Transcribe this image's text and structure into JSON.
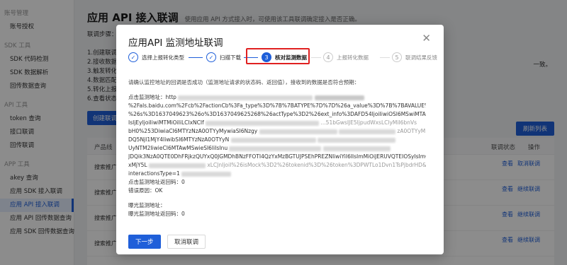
{
  "sidebar": {
    "sections": [
      {
        "group": "账号管理",
        "items": [
          "账号授权"
        ]
      },
      {
        "group": "SDK 工具",
        "items": [
          "SDK 代码检测",
          "SDK 数据解析",
          "回传数据查询"
        ]
      },
      {
        "group": "API 工具",
        "items": [
          "token 查询",
          "接口联调",
          "回传联调"
        ]
      },
      {
        "group": "APP 工具",
        "items": [
          "akey 查询",
          "应用 SDK 接入联调",
          "应用 API 接入联调",
          "应用 API 回传数据查询",
          "应用 SDK 回传数据查询"
        ]
      }
    ],
    "active_item": "应用 API 接入联调"
  },
  "main": {
    "title": "应用 API 接入联调",
    "desc": "使用应用 API 方式接入时，可使用该工具联调确定接入是否正确。",
    "steps_label": "联调步骤：",
    "steps": [
      "1.创建联调",
      "2.接收数据",
      "3.触发转化",
      "4.数据匹配",
      "5.转化上报",
      "6.查看状态"
    ],
    "create_button": "创建联调",
    "refresh_button": "刷新列表",
    "tail_right": "一致。",
    "table_headers": {
      "product": "产品线",
      "status": "联调状态",
      "action": "操作"
    },
    "rows": [
      {
        "product": "搜索推广",
        "actions": [
          "查看",
          "取消联调"
        ]
      },
      {
        "product": "搜索推广",
        "actions": [
          "查看",
          "继续联调"
        ]
      },
      {
        "product": "搜索推广",
        "actions": [
          "查看",
          "继续联调"
        ]
      },
      {
        "product": "搜索推广",
        "actions": [
          "查看",
          "继续联调"
        ]
      }
    ]
  },
  "modal": {
    "title": "应用API 监测地址联调",
    "close_icon": "close-icon",
    "steps": [
      {
        "index": "1",
        "label": "选择上报转化类型",
        "state": "done"
      },
      {
        "index": "2",
        "label": "扫描下载",
        "state": "done"
      },
      {
        "index": "3",
        "label": "核对监测数据",
        "state": "active"
      },
      {
        "index": "4",
        "label": "上报转化数据",
        "state": "pending"
      },
      {
        "index": "5",
        "label": "联调结果反馈",
        "state": "pending"
      }
    ],
    "description": "请确认监控地址的回调是否成功（监测地址请求的状态码、返回值），接收到的数据是否符合预期：",
    "click_url_label": "点击监测地址：",
    "click_url_lines": [
      "http",
      "%2Fals.baidu.com%2Fcb%2FactionCb%3Fa_type%3D%7B%7BATYPE%7D%7D%26a_value%3D%7B%7BAVALUE%7D%7D",
      "%26s%3D1637049623%26o%3D1637049625268%26actType%3D2%26ext_info%3DAFD54IjoiIiwiOSI6MSwiMTAiOiIiLClxMSI6Ii",
      "IsIjEyIjoiIiwiMTMiOiIiLCIxNCIf",
      "bH0%253DiwiaCI6MTYzNzA0OTYyMywiaSI6Nzgy",
      "DQ5NjI1MjY4IiwibSI6MTYzNzA0OTYyN",
      "UyNTM2IiwieCI6MTAwMSwieSI6IiIsInu",
      "JDQik3NzA0QTE0DhFRjkzQUYxQ0JGMDhBNzFFOTI4QzYxMzBGTUJPSEhPREZNIiwiYiI6IlsImMiOiJERUVQTEIOSyIsImQiOjk5NzQ",
      "xMjY5L",
      "interactionsType=1"
    ],
    "click_status_label": "点击监测地址返回码：",
    "click_status_value": "0",
    "click_error_label": "错误原因：",
    "click_error_value": "OK",
    "impression_url_label": "曝光监测地址：",
    "impression_status_label": "曝光监测地址返回码：",
    "impression_status_value": "0",
    "next_button": "下一步",
    "cancel_button": "取消联调"
  }
}
